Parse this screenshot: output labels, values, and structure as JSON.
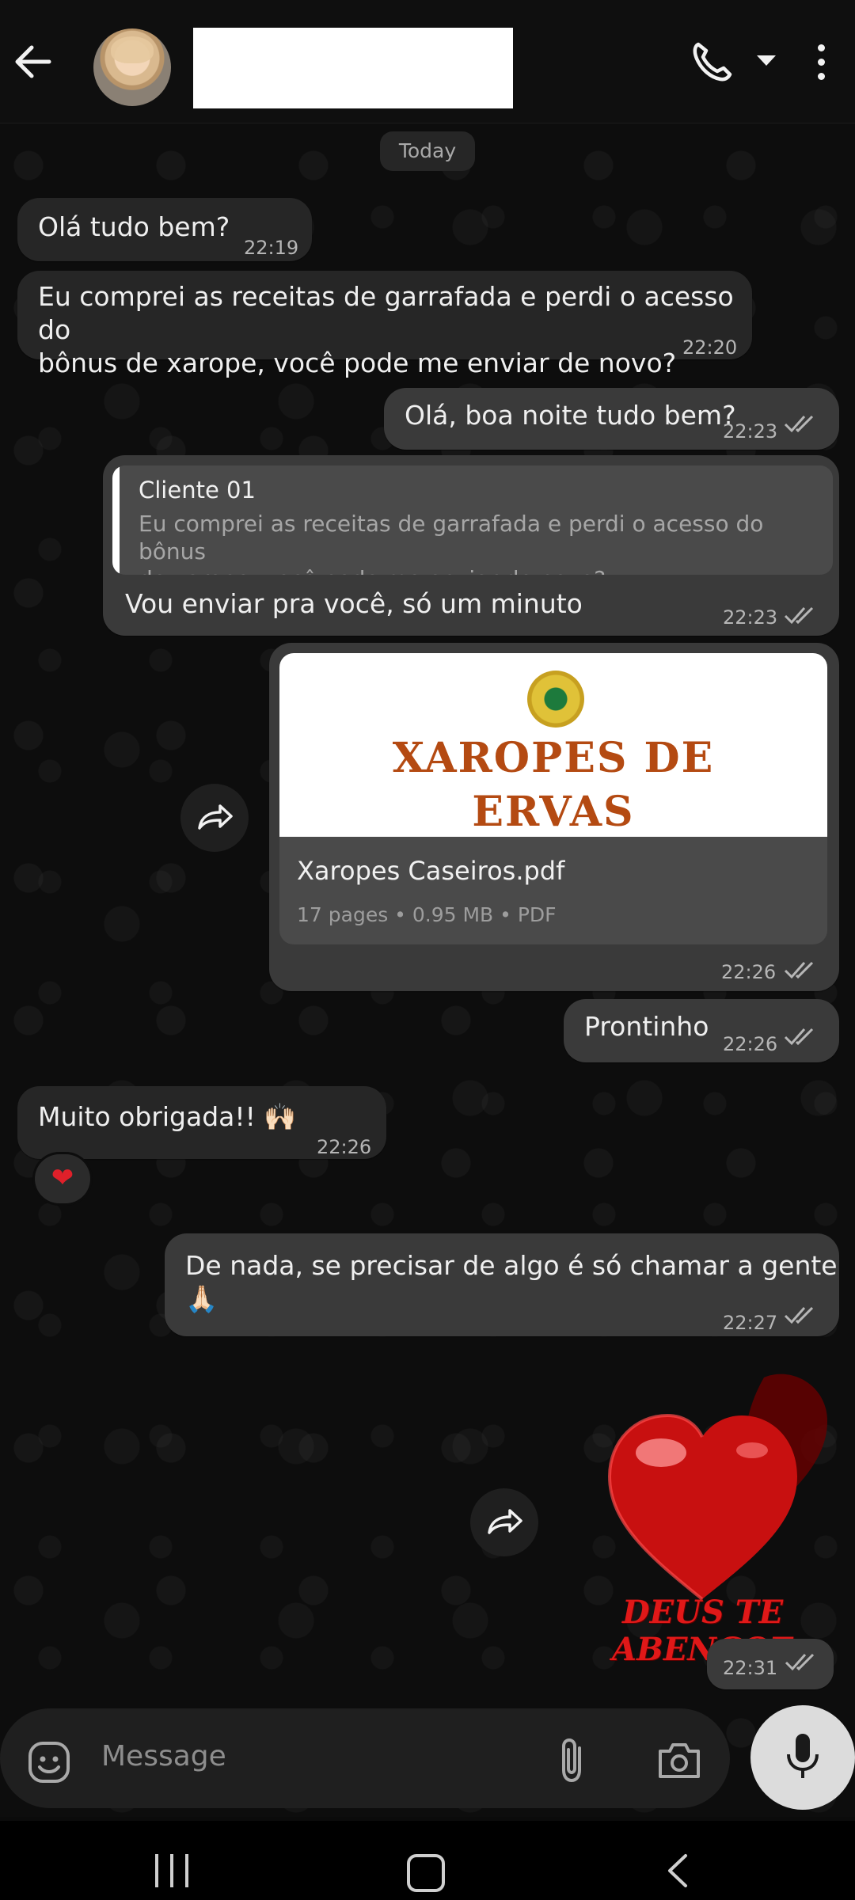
{
  "header": {
    "contact_name": "",
    "back_label": "back",
    "call_label": "voice call"
  },
  "date_chip": "Today",
  "messages": [
    {
      "text": "Olá tudo bem?",
      "time": "22:19"
    },
    {
      "text": "Eu comprei as receitas de garrafada e perdi o acesso do\nbônus de xarope, você pode me enviar de novo?",
      "time": "22:20"
    },
    {
      "text": "Olá, boa noite tudo bem?",
      "time": "22:23"
    },
    {
      "text": "Vou enviar pra você, só um minuto",
      "time": "22:23",
      "quote": {
        "name": "Cliente 01",
        "text": "Eu comprei as receitas de garrafada e perdi o acesso do bônus\nde xarope, você pode me enviar de novo?"
      }
    },
    {
      "time": "22:26",
      "document": {
        "thumb_title_line1": "XAROPES DE",
        "thumb_title_line2": "ERVAS",
        "file_name": "Xaropes Caseiros.pdf",
        "meta": "17 pages • 0.95 MB • PDF"
      }
    },
    {
      "text": "Prontinho",
      "time": "22:26"
    },
    {
      "text": "Muito obrigada!! 🙌🏻",
      "time": "22:26",
      "reaction": "❤"
    },
    {
      "text": "De nada, se precisar de algo é só chamar a gente 🙏🏻",
      "time": "22:27"
    },
    {
      "time": "22:31",
      "sticker_text": "DEUS TE ABENCOE"
    }
  ],
  "composer": {
    "placeholder": "Message"
  },
  "colors": {
    "incoming_bubble": "#262626",
    "outgoing_bubble": "#3a3a3a",
    "header": "#0f0f0f",
    "sticker_red": "#e01818"
  },
  "icons": [
    "back-arrow-icon",
    "phone-icon",
    "chevron-down-icon",
    "more-vert-icon",
    "forward-icon",
    "double-check-icon",
    "emoji-icon",
    "attach-icon",
    "camera-icon",
    "mic-icon"
  ]
}
